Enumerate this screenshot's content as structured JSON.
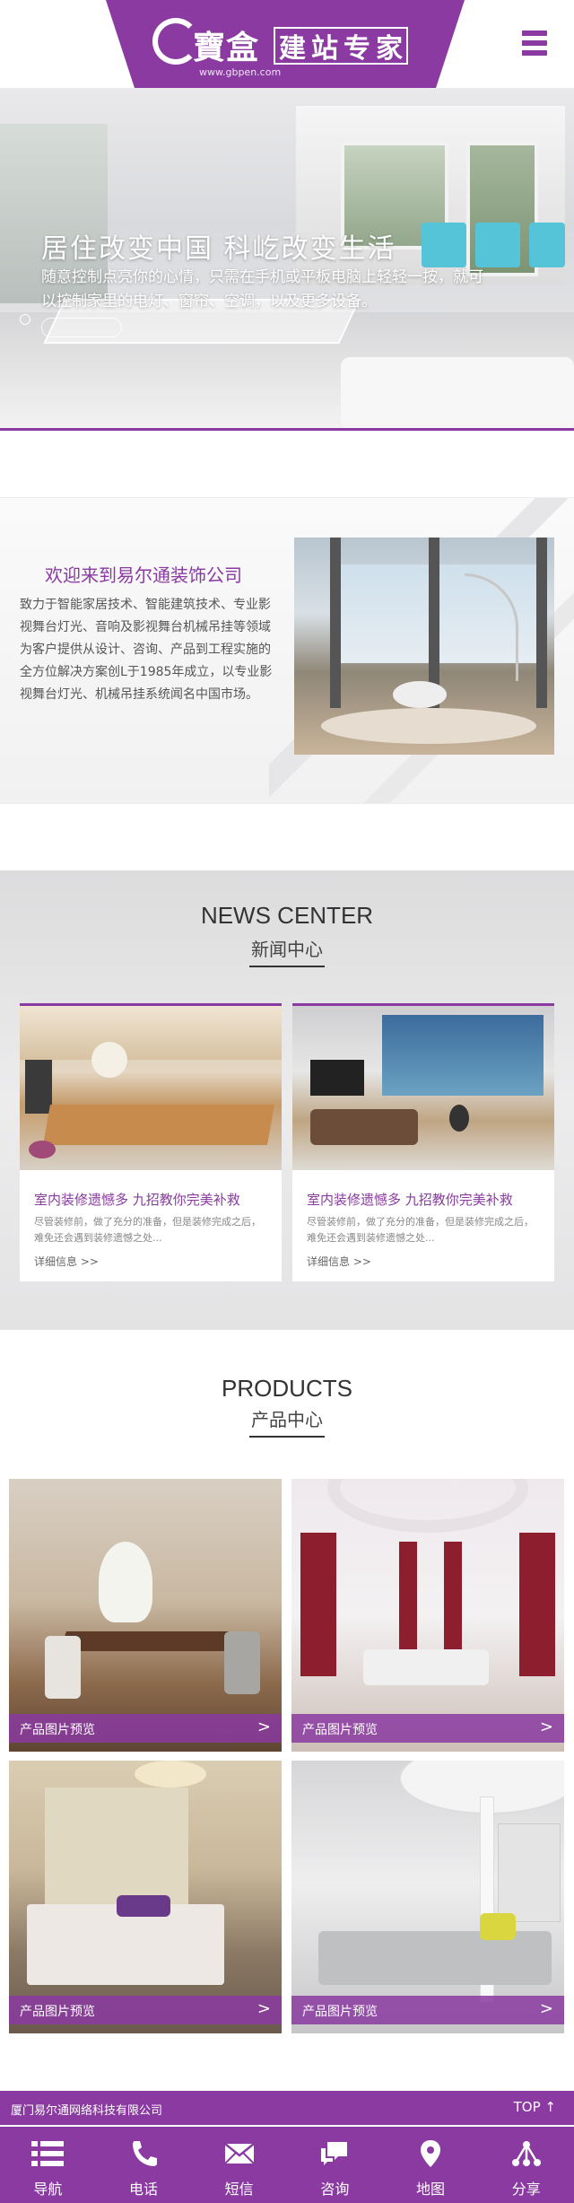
{
  "header": {
    "logo_letter": "G",
    "logo_cn": "寶盒",
    "logo_badge": [
      "建",
      "站",
      "专",
      "家"
    ],
    "logo_url": "www.gbpen.com",
    "menu_icon": "menu-icon"
  },
  "banner": {
    "title": "居住改变中国 科屹改变生活",
    "subtitle": "随意控制点亮你的心情，只需在手机或平板电脑上轻轻一按，就可以控制家里的电灯、窗帘、空调，以及更多设备。"
  },
  "about": {
    "title": "欢迎来到易尔通装饰公司",
    "text": "致力于智能家居技术、智能建筑技术、专业影视舞台灯光、音响及影视舞台机械吊挂等领域为客户提供从设计、咨询、产品到工程实施的全方位解决方案创L于1985年成立，以专业影视舞台灯光、机械吊挂系统闻名中国市场。"
  },
  "news": {
    "title_en": "NEWS CENTER",
    "title_cn": "新闻中心",
    "items": [
      {
        "title": "室内装修遗憾多 九招教你完美补救",
        "desc": "尽管装修前，做了充分的准备，但是装修完成之后，难免还会遇到装修遗憾之处...",
        "more": "详细信息 >>"
      },
      {
        "title": "室内装修遗憾多 九招教你完美补救",
        "desc": "尽管装修前，做了充分的准备，但是装修完成之后，难免还会遇到装修遗憾之处...",
        "more": "详细信息 >>"
      }
    ]
  },
  "products": {
    "title_en": "PRODUCTS",
    "title_cn": "产品中心",
    "items": [
      {
        "label": "产品图片预览",
        "arrow": ">"
      },
      {
        "label": "产品图片预览",
        "arrow": ">"
      },
      {
        "label": "产品图片预览",
        "arrow": ">"
      },
      {
        "label": "产品图片预览",
        "arrow": ">"
      }
    ]
  },
  "footer": {
    "company": "厦门易尔通网络科技有限公司",
    "top": "TOP ↑"
  },
  "bottom_nav": [
    {
      "label": "导航",
      "icon": "list-icon"
    },
    {
      "label": "电话",
      "icon": "phone-icon"
    },
    {
      "label": "短信",
      "icon": "mail-icon"
    },
    {
      "label": "咨询",
      "icon": "chat-icon"
    },
    {
      "label": "地图",
      "icon": "map-pin-icon"
    },
    {
      "label": "分享",
      "icon": "share-icon"
    }
  ],
  "colors": {
    "accent": "#8a3aa0",
    "background": "#ffffff"
  }
}
